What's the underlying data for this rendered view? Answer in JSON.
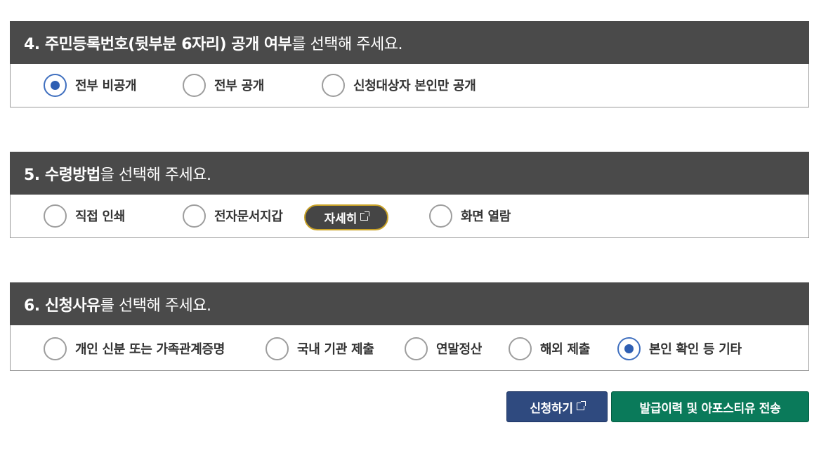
{
  "sections": [
    {
      "head_strong": "4. 주민등록번호(뒷부분 6자리) 공개 여부",
      "head_normal": "를 선택해 주세요.",
      "options": [
        "전부 비공개",
        "전부 공개",
        "신청대상자 본인만 공개"
      ],
      "selected": 0
    },
    {
      "head_strong": "5. 수령방법",
      "head_normal": "을 선택해 주세요.",
      "options": [
        "직접 인쇄",
        "전자문서지갑",
        "화면 열람"
      ],
      "detail_label": "자세히",
      "selected": null
    },
    {
      "head_strong": "6. 신청사유",
      "head_normal": "를 선택해 주세요.",
      "options": [
        "개인 신분 또는 가족관계증명",
        "국내 기관 제출",
        "연말정산",
        "해외 제출",
        "본인 확인 등 기타"
      ],
      "selected": 4
    }
  ],
  "actions": {
    "apply_label": "신청하기",
    "send_label": "발급이력 및 아포스티유 전송"
  },
  "colors": {
    "header_bg": "#4a4a4a",
    "radio_selected": "#2f5fb3",
    "apply_button": "#2f4a7f",
    "send_button": "#0a7a5a",
    "detail_border": "#c9a227"
  }
}
